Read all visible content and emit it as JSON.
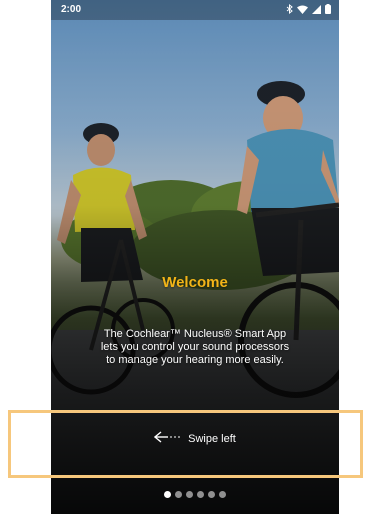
{
  "status_bar": {
    "time": "2:00",
    "icons": [
      "bluetooth-icon",
      "wifi-icon",
      "signal-icon",
      "battery-icon"
    ]
  },
  "onboarding": {
    "title": "Welcome",
    "body": "The Cochlear™ Nucleus® Smart App lets you control your sound processors to manage your hearing more easily.",
    "swipe_label": "Swipe left",
    "swipe_icon": "arrow-left-icon",
    "page_count": 6,
    "current_page": 1
  },
  "colors": {
    "title": "#f2b418",
    "highlight": "#f6c77c"
  }
}
